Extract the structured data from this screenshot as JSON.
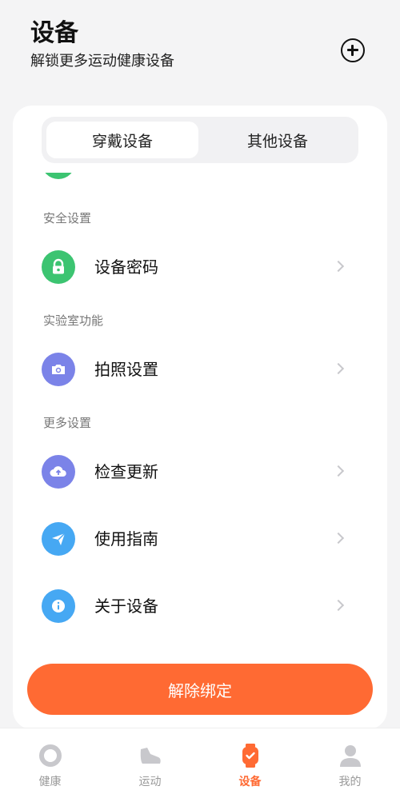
{
  "header": {
    "title": "设备",
    "subtitle": "解锁更多运动健康设备"
  },
  "segmented": {
    "tabs": [
      {
        "label": "穿戴设备",
        "active": true
      },
      {
        "label": "其他设备",
        "active": false
      }
    ]
  },
  "partial_row": {
    "label": "..."
  },
  "sections": [
    {
      "label": "安全设置",
      "items": [
        {
          "label": "设备密码",
          "icon": "lock-icon",
          "color": "#3cc471"
        }
      ]
    },
    {
      "label": "实验室功能",
      "items": [
        {
          "label": "拍照设置",
          "icon": "camera-icon",
          "color": "#7b83e8"
        }
      ]
    },
    {
      "label": "更多设置",
      "items": [
        {
          "label": "检查更新",
          "icon": "cloud-upload-icon",
          "color": "#7b83e8"
        },
        {
          "label": "使用指南",
          "icon": "paper-plane-icon",
          "color": "#46a8f3"
        },
        {
          "label": "关于设备",
          "icon": "info-icon",
          "color": "#46a8f3"
        }
      ]
    }
  ],
  "unbind_button": {
    "label": "解除绑定",
    "color": "#ff6a33"
  },
  "tabbar": {
    "tabs": [
      {
        "label": "健康",
        "icon": "health-ring-icon",
        "active": false
      },
      {
        "label": "运动",
        "icon": "shoe-icon",
        "active": false
      },
      {
        "label": "设备",
        "icon": "watch-icon",
        "active": true
      },
      {
        "label": "我的",
        "icon": "person-icon",
        "active": false
      }
    ]
  },
  "colors": {
    "accent": "#ff6a33",
    "background": "#f4f4f5"
  }
}
